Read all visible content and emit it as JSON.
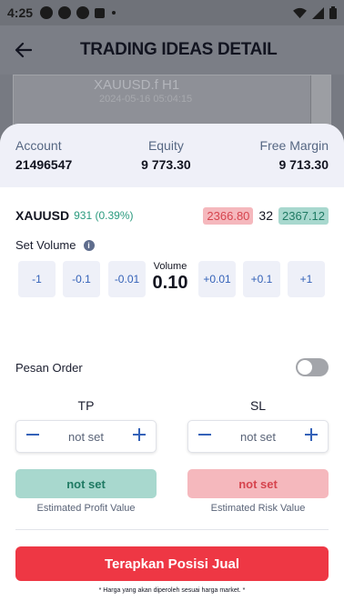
{
  "status_bar": {
    "time": "4:25"
  },
  "header": {
    "title": "TRADING IDEAS DETAIL"
  },
  "chart_preview": {
    "symbol": "XAUUSD.f H1",
    "time": "2024-05-16 05:04:15"
  },
  "summary": {
    "account_label": "Account",
    "account_value": "21496547",
    "equity_label": "Equity",
    "equity_value": "9 773.30",
    "free_margin_label": "Free Margin",
    "free_margin_value": "9 713.30"
  },
  "symbol": {
    "name": "XAUUSD",
    "change": "931 (0.39%)",
    "bid": "2366.80",
    "spread": "32",
    "ask": "2367.12"
  },
  "volume": {
    "label": "Set Volume",
    "info_icon": "info-icon",
    "buttons": [
      "-1",
      "-0.1",
      "-0.01",
      "+0.01",
      "+0.1",
      "+1"
    ],
    "center_label": "Volume",
    "value": "0.10"
  },
  "pesan_order": {
    "label": "Pesan Order",
    "enabled": false
  },
  "tp": {
    "title": "TP",
    "value": "not set",
    "estimate": "not set",
    "caption": "Estimated Profit Value"
  },
  "sl": {
    "title": "SL",
    "value": "not set",
    "estimate": "not set",
    "caption": "Estimated Risk Value"
  },
  "action": {
    "apply_label": "Terapkan Posisi Jual",
    "note": "* Harga yang akan diperoleh sesuai harga market. *"
  },
  "colors": {
    "sell": "#ee3744",
    "bid_bg": "#f5b8bd",
    "ask_bg": "#a8d8ce",
    "accent": "#3462b8"
  }
}
